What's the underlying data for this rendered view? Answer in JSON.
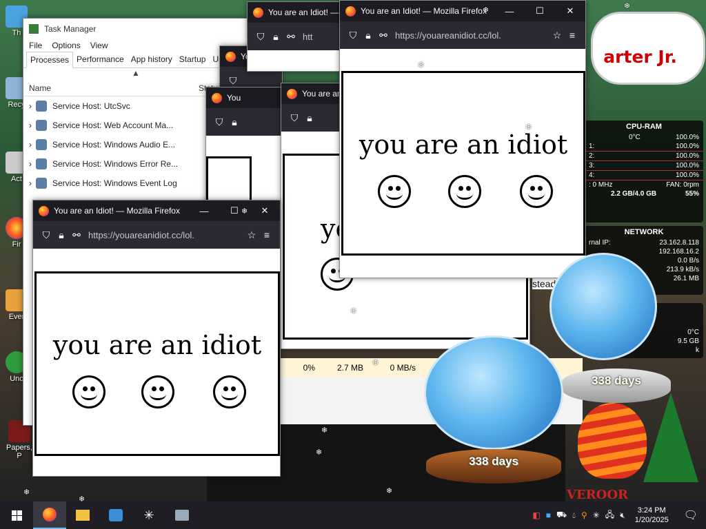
{
  "desktop": {
    "icons": [
      {
        "label": "Th"
      },
      {
        "label": "Recy"
      },
      {
        "label": "Act"
      },
      {
        "label": "Fir"
      },
      {
        "label": "Ever"
      },
      {
        "label": "Unc"
      },
      {
        "label": "Papers, P"
      }
    ],
    "banner_text": "arter Jr."
  },
  "task_manager": {
    "title": "Task Manager",
    "menu": [
      "File",
      "Options",
      "View"
    ],
    "tabs": [
      "Processes",
      "Performance",
      "App history",
      "Startup",
      "Us"
    ],
    "column_name": "Name",
    "column_status": "Status",
    "rows": [
      "Service Host: UtcSvc",
      "Service Host: Web Account Ma...",
      "Service Host: Windows Audio E...",
      "Service Host: Windows Error Re...",
      "Service Host: Windows Event Log"
    ],
    "footer_cpu": "0%",
    "footer_mem": "2.7 MB",
    "footer_disk": "0 MB/s",
    "partial_text": "stead"
  },
  "firefox": {
    "window_title": "You are an Idiot! — Mozilla Firefox",
    "short_title": "You are an Idiot! —",
    "tiny_title": "You",
    "url": "https://youareanidiot.cc/lol.",
    "url_short": "htt",
    "page_text": "you are an idiot",
    "page_text_partial": "yo"
  },
  "cpu_gadget": {
    "title": "CPU-RAM",
    "temp": "0°C",
    "total": "100.0%",
    "cores": [
      {
        "label": "1:",
        "value": "100.0%"
      },
      {
        "label": "2:",
        "value": "100.0%"
      },
      {
        "label": "3:",
        "value": "100.0%"
      },
      {
        "label": "4:",
        "value": "100.0%"
      }
    ],
    "freq": ": 0 MHz",
    "fan": "FAN: 0rpm",
    "ram": "2.2 GB/4.0 GB",
    "ram_pct": "55%"
  },
  "network_gadget": {
    "title": "NETWORK",
    "ext_label": "rnal IP:",
    "ext_ip": "23.162.8.118",
    "int_ip": "192.168.16.2",
    "up": "0.0 B/s",
    "down": "213.9 kB/s",
    "total": "26.1 MB"
  },
  "disk_gadget": {
    "temp": "0°C",
    "size": "9.5 GB",
    "extra": "k"
  },
  "globes": {
    "big_label": "338 days",
    "small_label": "338 days"
  },
  "bottom_text": "VEROOR",
  "taskbar": {
    "time": "3:24 PM",
    "date": "1/20/2025"
  },
  "colors": {
    "firefox_titlebar": "#1c1b22",
    "firefox_navbar": "#2b2a33",
    "taskbar": "#1e1e24"
  }
}
